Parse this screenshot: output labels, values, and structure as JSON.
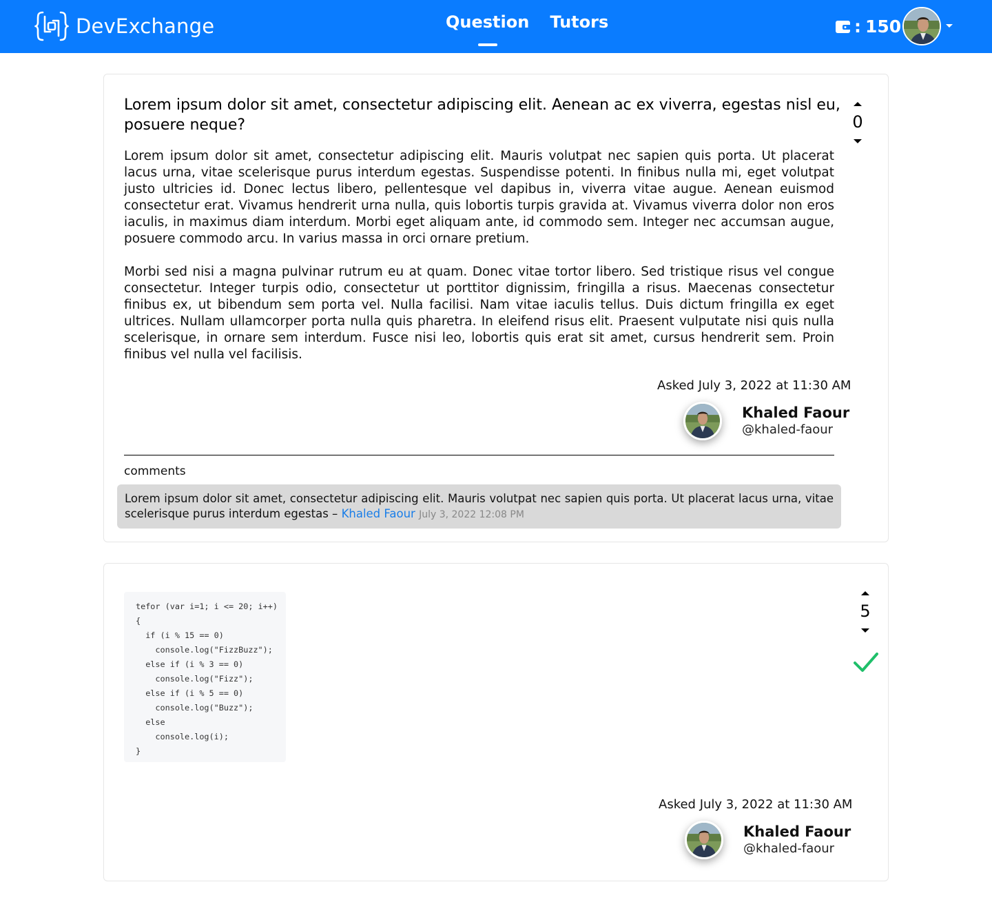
{
  "header": {
    "brand": "DevExchange",
    "nav": [
      {
        "label": "Question",
        "active": true
      },
      {
        "label": "Tutors",
        "active": false
      }
    ],
    "wallet": {
      "icon": "wallet-icon",
      "separator": ":",
      "balance": "150"
    },
    "accent_color": "#0a7cff"
  },
  "question": {
    "title": "Lorem ipsum dolor sit amet, consectetur adipiscing elit. Aenean ac ex viverra, egestas nisl eu, posuere neque?",
    "body": [
      "Lorem ipsum dolor sit amet, consectetur adipiscing elit. Mauris volutpat nec sapien quis porta. Ut placerat lacus urna, vitae scelerisque purus interdum egestas. Suspendisse potenti. In finibus nulla mi, eget volutpat justo ultricies id. Donec lectus libero, pellentesque vel dapibus in, viverra vitae augue. Aenean euismod consectetur erat. Vivamus hendrerit urna nulla, quis lobortis turpis gravida at. Vivamus viverra dolor non eros iaculis, in maximus diam interdum. Morbi eget aliquam ante, id commodo sem. Integer nec accumsan augue, posuere commodo arcu. In varius massa in orci ornare pretium.",
      "Morbi sed nisi a magna pulvinar rutrum eu at quam. Donec vitae tortor libero. Sed tristique risus vel congue consectetur. Integer turpis odio, consectetur ut porttitor dignissim, fringilla a risus. Maecenas consectetur finibus ex, ut bibendum sem porta vel. Nulla facilisi. Nam vitae iaculis tellus. Duis dictum fringilla ex eget ultrices. Nullam ullamcorper porta nulla quis pharetra. In eleifend risus elit. Praesent vulputate nisi quis nulla scelerisque, in ornare sem interdum. Fusce nisi leo, lobortis quis erat sit amet, cursus hendrerit sem. Proin finibus vel nulla vel facilisis."
    ],
    "votes": "0",
    "asked": "Asked July 3, 2022 at 11:30 AM",
    "author": {
      "name": "Khaled Faour",
      "handle": "@khaled-faour"
    },
    "comments_label": "comments",
    "comments": [
      {
        "text": "Lorem ipsum dolor sit amet, consectetur adipiscing elit. Mauris volutpat nec sapien quis porta. Ut placerat lacus urna, vitae scelerisque purus interdum egestas –",
        "author": "Khaled Faour",
        "date": "July 3, 2022 12:08 PM"
      }
    ]
  },
  "answer": {
    "code": "tefor (var i=1; i <= 20; i++)\n{\n  if (i % 15 == 0)\n    console.log(\"FizzBuzz\");\n  else if (i % 3 == 0)\n    console.log(\"Fizz\");\n  else if (i % 5 == 0)\n    console.log(\"Buzz\");\n  else\n    console.log(i);\n}",
    "votes": "5",
    "accepted": true,
    "accepted_color": "#1fbf6a",
    "asked": "Asked July 3, 2022 at 11:30 AM",
    "author": {
      "name": "Khaled Faour",
      "handle": "@khaled-faour"
    }
  }
}
